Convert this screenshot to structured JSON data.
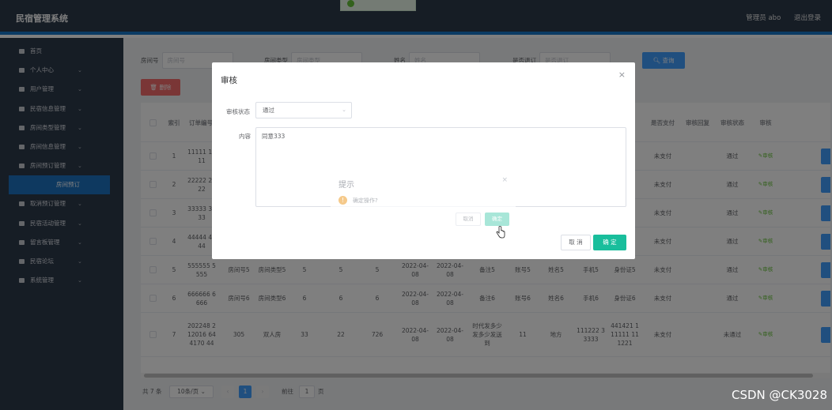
{
  "header": {
    "brand": "民宿管理系统",
    "user": "管理员 abo",
    "logout": "退出登录"
  },
  "sidebar": {
    "items": [
      {
        "label": "首页",
        "icon": "home-icon",
        "chevron": false
      },
      {
        "label": "个人中心",
        "icon": "user-icon",
        "chevron": true
      },
      {
        "label": "用户管理",
        "icon": "grid-icon",
        "chevron": true
      },
      {
        "label": "民宿信息管理",
        "icon": "id-card-icon",
        "chevron": true
      },
      {
        "label": "房间类型管理",
        "icon": "send-icon",
        "chevron": true
      },
      {
        "label": "房间信息管理",
        "icon": "monitor-icon",
        "chevron": true
      },
      {
        "label": "房间预订管理",
        "icon": "grid-icon",
        "chevron": true
      }
    ],
    "submenu_label": "房间预订",
    "items_after": [
      {
        "label": "取消预订管理",
        "icon": "list-icon",
        "chevron": true
      },
      {
        "label": "民宿活动管理",
        "icon": "bar-chart-icon",
        "chevron": true
      },
      {
        "label": "留言板管理",
        "icon": "grid-icon",
        "chevron": true
      },
      {
        "label": "民宿论坛",
        "icon": "grid-icon",
        "chevron": true
      },
      {
        "label": "系统管理",
        "icon": "clipboard-icon",
        "chevron": true
      }
    ]
  },
  "search": {
    "fields": [
      {
        "label": "房间号",
        "placeholder": "房间号"
      },
      {
        "label": "房间类型",
        "placeholder": "房间类型"
      },
      {
        "label": "姓名",
        "placeholder": "姓名"
      },
      {
        "label": "是否退订",
        "placeholder": "是否退订"
      }
    ],
    "button": "查询"
  },
  "toolbar": {
    "delete": "删除"
  },
  "table": {
    "headers": [
      "索引",
      "订单编号",
      "是否支付",
      "审核回复",
      "审核状态",
      "审核"
    ],
    "rows": [
      {
        "idx": "1",
        "order": "11111 1111",
        "paid": "未支付",
        "status": "通过",
        "audit": "审核"
      },
      {
        "idx": "2",
        "order": "22222 2222",
        "paid": "未支付",
        "status": "通过",
        "audit": "审核"
      },
      {
        "idx": "3",
        "order": "33333 3333",
        "paid": "未支付",
        "status": "通过",
        "audit": "审核"
      },
      {
        "idx": "4",
        "order": "44444 4444",
        "paid": "未支付",
        "status": "通过",
        "audit": "审核"
      },
      {
        "idx": "5",
        "order": "555555 5555",
        "room": "房间号5",
        "type": "房间类型5",
        "c1": "5",
        "c2": "5",
        "c3": "5",
        "d1": "2022-04-08",
        "d2": "2022-04-08",
        "note": "备注5",
        "acct": "账号5",
        "name": "姓名5",
        "phone": "手机5",
        "idcard": "身份证5",
        "paid": "未支付",
        "status": "通过",
        "audit": "审核"
      },
      {
        "idx": "6",
        "order": "666666 6666",
        "room": "房间号6",
        "type": "房间类型6",
        "c1": "6",
        "c2": "6",
        "c3": "6",
        "d1": "2022-04-08",
        "d2": "2022-04-08",
        "note": "备注6",
        "acct": "账号6",
        "name": "姓名6",
        "phone": "手机6",
        "idcard": "身份证6",
        "paid": "未支付",
        "status": "通过",
        "audit": "审核"
      },
      {
        "idx": "7",
        "order": "202248 212016 644170 44",
        "room": "305",
        "type": "双人房",
        "c1": "33",
        "c2": "22",
        "c3": "726",
        "d1": "2022-04-08",
        "d2": "2022-04-08",
        "note": "时代发多少发多少发送到",
        "acct": "11",
        "name": "地方",
        "phone": "111222 33333",
        "idcard": "441421 111111 111221",
        "paid": "未支付",
        "status": "未通过",
        "audit": "审核"
      }
    ]
  },
  "pager": {
    "total": "共 7 条",
    "size": "10条/页",
    "page": "1",
    "goto": "前往",
    "goto_value": "1",
    "page_unit": "页"
  },
  "dialog": {
    "title": "审核",
    "status_label": "审核状态",
    "status_value": "通过",
    "content_label": "内容",
    "content_value": "同意333",
    "cancel": "取 消",
    "ok": "确 定"
  },
  "confirm": {
    "title": "提示",
    "message": "确定操作?",
    "cancel": "取消",
    "ok": "确定"
  },
  "watermark": "CSDN @CK3028"
}
